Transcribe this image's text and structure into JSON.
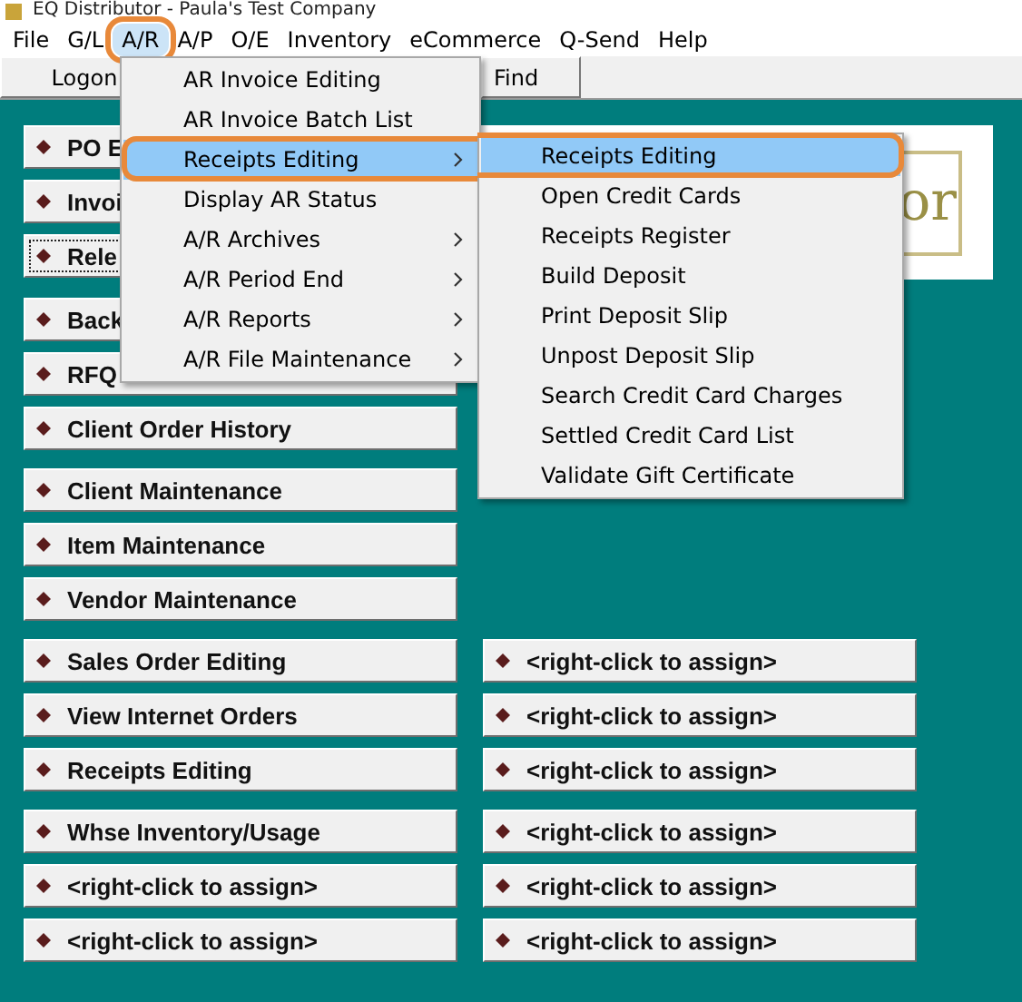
{
  "window": {
    "title": "EQ Distributor - Paula's Test Company"
  },
  "menu_bar": [
    {
      "label": "File",
      "selected": false,
      "annotated": false
    },
    {
      "label": "G/L",
      "selected": false,
      "annotated": false
    },
    {
      "label": "A/R",
      "selected": true,
      "annotated": true
    },
    {
      "label": "A/P",
      "selected": false,
      "annotated": false
    },
    {
      "label": "O/E",
      "selected": false,
      "annotated": false
    },
    {
      "label": "Inventory",
      "selected": false,
      "annotated": false
    },
    {
      "label": "eCommerce",
      "selected": false,
      "annotated": false
    },
    {
      "label": "Q-Send",
      "selected": false,
      "annotated": false
    },
    {
      "label": "Help",
      "selected": false,
      "annotated": false
    }
  ],
  "toolbar": [
    {
      "label": "Logon"
    },
    {
      "label": "Find"
    }
  ],
  "logo": {
    "text": "or"
  },
  "left_shortcuts": [
    [
      {
        "label": "PO E",
        "focused": false
      },
      {
        "label": "Invoi",
        "focused": false
      },
      {
        "label": "Rele",
        "focused": true
      }
    ],
    [
      {
        "label": "Back",
        "focused": false
      },
      {
        "label": "RFQ",
        "focused": false
      },
      {
        "label": "Client Order History",
        "focused": false
      }
    ],
    [
      {
        "label": "Client Maintenance",
        "focused": false
      },
      {
        "label": "Item Maintenance",
        "focused": false
      },
      {
        "label": "Vendor Maintenance",
        "focused": false
      }
    ],
    [
      {
        "label": "Sales Order Editing",
        "focused": false
      },
      {
        "label": "View Internet Orders",
        "focused": false
      },
      {
        "label": "Receipts Editing",
        "focused": false
      }
    ],
    [
      {
        "label": "Whse Inventory/Usage",
        "focused": false
      },
      {
        "label": "<right-click to assign>",
        "focused": false
      },
      {
        "label": "<right-click to assign>",
        "focused": false
      }
    ]
  ],
  "right_shortcuts": [
    [
      {
        "label": "<right-click to assign>",
        "focused": false
      },
      {
        "label": "<right-click to assign>",
        "focused": false
      },
      {
        "label": "<right-click to assign>",
        "focused": false
      }
    ],
    [
      {
        "label": "<right-click to assign>",
        "focused": false
      },
      {
        "label": "<right-click to assign>",
        "focused": false
      },
      {
        "label": "<right-click to assign>",
        "focused": false
      }
    ]
  ],
  "ar_menu": [
    {
      "label": "AR Invoice Editing",
      "has_submenu": false,
      "selected": false,
      "annotated": false
    },
    {
      "label": "AR Invoice Batch List",
      "has_submenu": false,
      "selected": false,
      "annotated": false
    },
    {
      "label": "Receipts Editing",
      "has_submenu": true,
      "selected": true,
      "annotated": true
    },
    {
      "label": "Display AR Status",
      "has_submenu": false,
      "selected": false,
      "annotated": false
    },
    {
      "label": "A/R Archives",
      "has_submenu": true,
      "selected": false,
      "annotated": false
    },
    {
      "label": "A/R Period End",
      "has_submenu": true,
      "selected": false,
      "annotated": false
    },
    {
      "label": "A/R Reports",
      "has_submenu": true,
      "selected": false,
      "annotated": false
    },
    {
      "label": "A/R File Maintenance",
      "has_submenu": true,
      "selected": false,
      "annotated": false
    }
  ],
  "receipts_submenu": [
    {
      "label": "Receipts Editing",
      "selected": true,
      "annotated": true
    },
    {
      "label": "Open Credit Cards",
      "selected": false,
      "annotated": false
    },
    {
      "label": "Receipts Register",
      "selected": false,
      "annotated": false
    },
    {
      "label": "Build Deposit",
      "selected": false,
      "annotated": false
    },
    {
      "label": "Print Deposit Slip",
      "selected": false,
      "annotated": false
    },
    {
      "label": "Unpost Deposit Slip",
      "selected": false,
      "annotated": false
    },
    {
      "label": "Search Credit Card Charges",
      "selected": false,
      "annotated": false
    },
    {
      "label": "Settled Credit Card List",
      "selected": false,
      "annotated": false
    },
    {
      "label": "Validate Gift Certificate",
      "selected": false,
      "annotated": false
    }
  ]
}
